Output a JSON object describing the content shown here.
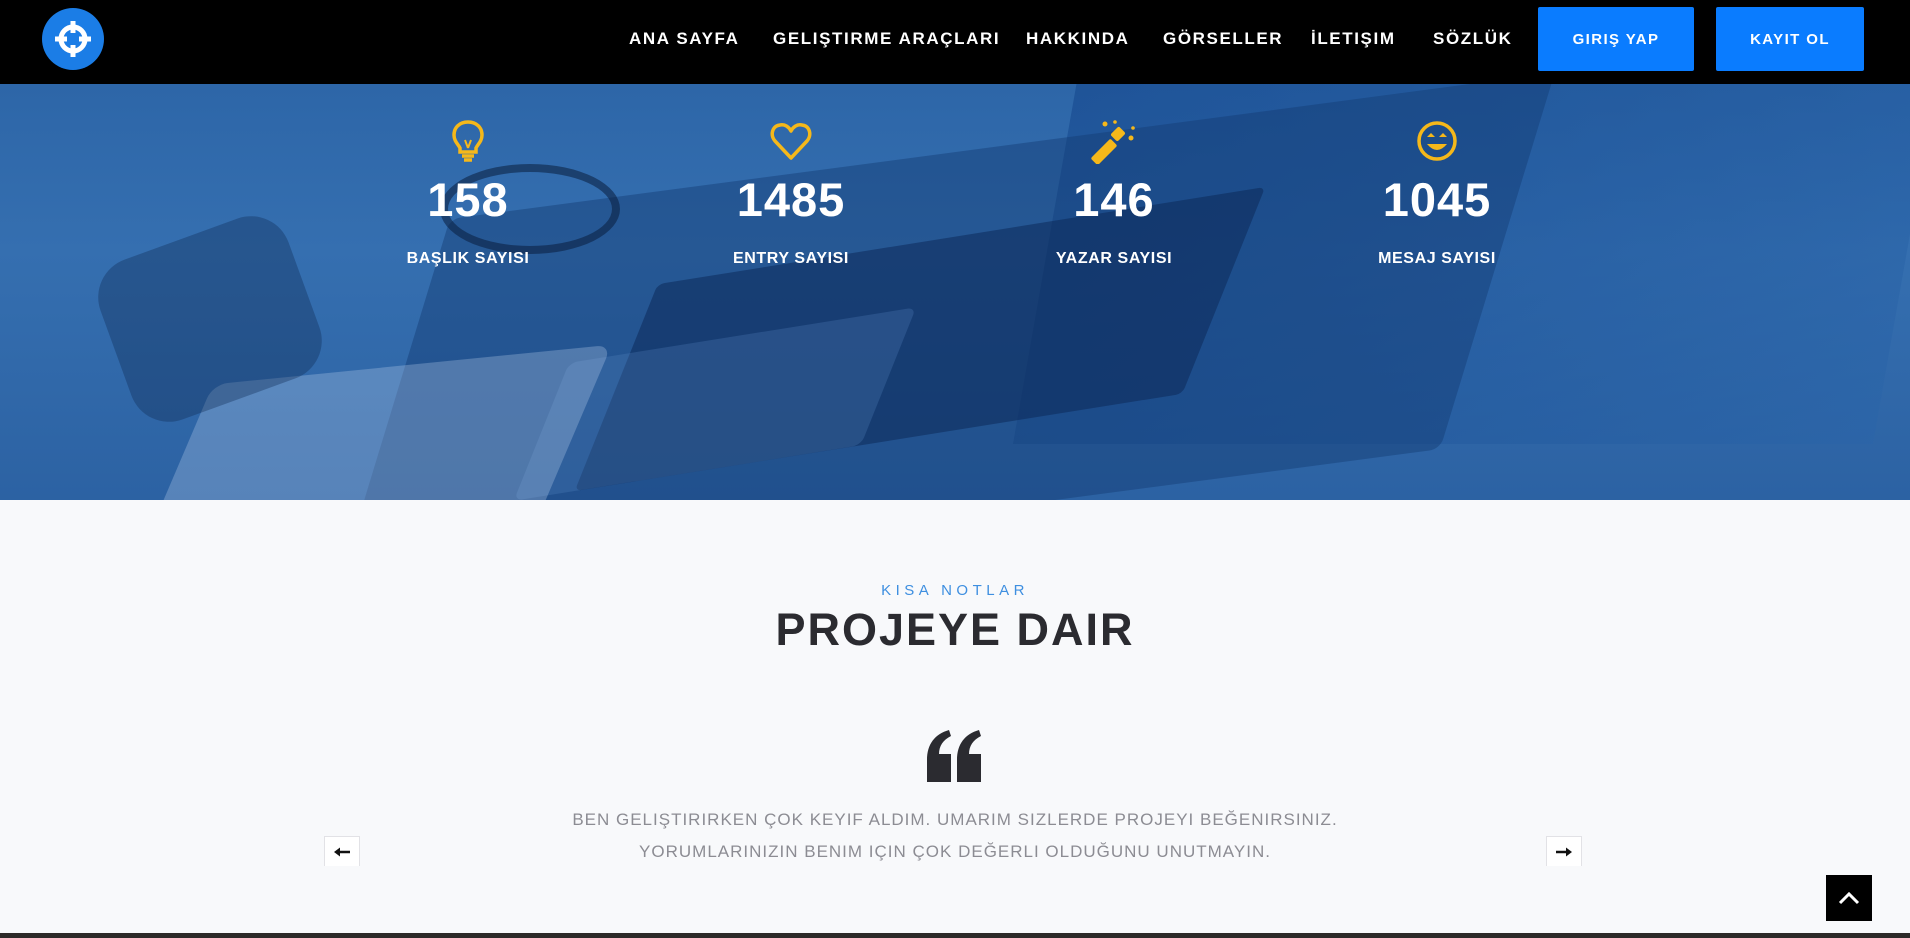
{
  "navbar": {
    "links": [
      {
        "label": "ANA SAYFA"
      },
      {
        "label": "GELIŞTIRME ARAÇLARI"
      },
      {
        "label": "HAKKINDA"
      },
      {
        "label": "GÖRSELLER"
      },
      {
        "label": "İLETIŞIM"
      },
      {
        "label": "SÖZLÜK"
      }
    ],
    "login_label": "GIRIŞ YAP",
    "register_label": "KAYIT OL"
  },
  "stats": [
    {
      "icon": "lightbulb-icon",
      "number": "158",
      "label": "BAŞLIK SAYISI"
    },
    {
      "icon": "heart-icon",
      "number": "1485",
      "label": "ENTRY SAYISI"
    },
    {
      "icon": "magic-wand-icon",
      "number": "146",
      "label": "YAZAR SAYISI"
    },
    {
      "icon": "smile-icon",
      "number": "1045",
      "label": "MESAJ SAYISI"
    }
  ],
  "notes": {
    "eyebrow": "KISA NOTLAR",
    "title": "PROJEYE DAIR",
    "quote_lines": [
      "BEN GELIŞTIRIRKEN ÇOK KEYIF ALDIM. UMARIM SIZLERDE PROJEYI BEĞENIRSINIZ.",
      "YORUMLARINIZIN BENIM IÇIN ÇOK DEĞERLI OLDUĞUNU UNUTMAYIN."
    ]
  },
  "colors": {
    "accent": "#0a7cff",
    "icon_yellow": "#f5b81a",
    "hero_blue": "#2f68aa",
    "navbar": "#000000"
  }
}
